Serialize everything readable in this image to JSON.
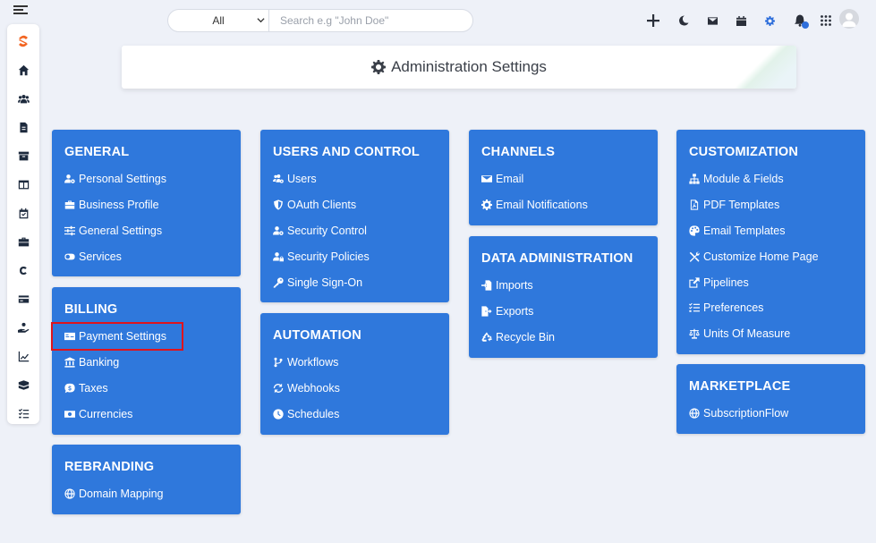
{
  "search": {
    "scope_value": "All",
    "placeholder": "Search e.g \"John Doe\""
  },
  "header": {
    "title": "Administration Settings"
  },
  "sidebar": {
    "items": [
      {
        "icon": "logo-icon"
      },
      {
        "icon": "home-icon"
      },
      {
        "icon": "users-icon"
      },
      {
        "icon": "file-icon"
      },
      {
        "icon": "archive-icon"
      },
      {
        "icon": "columns-icon"
      },
      {
        "icon": "calendar-check-icon"
      },
      {
        "icon": "briefcase-icon"
      },
      {
        "icon": "c-icon"
      },
      {
        "icon": "credit-card-icon"
      },
      {
        "icon": "hand-holding-icon"
      },
      {
        "icon": "chart-icon"
      },
      {
        "icon": "boxes-icon"
      },
      {
        "icon": "tasks-icon"
      }
    ]
  },
  "topbar": {
    "icons": [
      "plus-icon",
      "moon-icon",
      "mail-icon",
      "calendar-icon",
      "gear-icon",
      "bell-icon",
      "grid-icon",
      "avatar"
    ],
    "accent": "#2f6fdb"
  },
  "colors": {
    "card": "#2f78dc",
    "highlight": "#e0131c",
    "background": "#eef1f8"
  },
  "cards": {
    "general": {
      "title": "GENERAL",
      "items": [
        "Personal Settings",
        "Business Profile",
        "General Settings",
        "Services"
      ]
    },
    "billing": {
      "title": "BILLING",
      "items": [
        "Payment Settings",
        "Banking",
        "Taxes",
        "Currencies"
      ]
    },
    "rebranding": {
      "title": "REBRANDING",
      "items": [
        "Domain Mapping"
      ]
    },
    "users": {
      "title": "USERS AND CONTROL",
      "items": [
        "Users",
        "OAuth Clients",
        "Security Control",
        "Security Policies",
        "Single Sign-On"
      ]
    },
    "automation": {
      "title": "AUTOMATION",
      "items": [
        "Workflows",
        "Webhooks",
        "Schedules"
      ]
    },
    "channels": {
      "title": "CHANNELS",
      "items": [
        "Email",
        "Email Notifications"
      ]
    },
    "data_admin": {
      "title": "DATA ADMINISTRATION",
      "items": [
        "Imports",
        "Exports",
        "Recycle Bin"
      ]
    },
    "customization": {
      "title": "CUSTOMIZATION",
      "items": [
        "Module & Fields",
        "PDF Templates",
        "Email Templates",
        "Customize Home Page",
        "Pipelines",
        "Preferences",
        "Units Of Measure"
      ]
    },
    "marketplace": {
      "title": "MARKETPLACE",
      "items": [
        "SubscriptionFlow"
      ]
    }
  }
}
